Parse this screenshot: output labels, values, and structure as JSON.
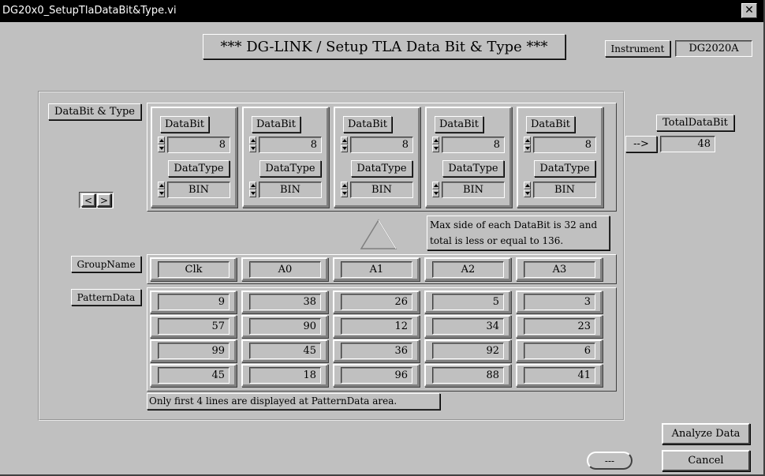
{
  "window": {
    "title": "DG20x0_SetupTlaDataBit&Type.vi",
    "close_glyph": "✕"
  },
  "header": {
    "title": "*** DG-LINK / Setup TLA Data Bit & Type ***"
  },
  "instrument": {
    "label": "Instrument",
    "value": "DG2020A"
  },
  "databit_type": {
    "label": "DataBit & Type",
    "cluster_labels": {
      "databit": "DataBit",
      "datatype": "DataType"
    },
    "clusters": [
      {
        "databit": "8",
        "datatype": "BIN"
      },
      {
        "databit": "8",
        "datatype": "BIN"
      },
      {
        "databit": "8",
        "datatype": "BIN"
      },
      {
        "databit": "8",
        "datatype": "BIN"
      },
      {
        "databit": "8",
        "datatype": "BIN"
      }
    ]
  },
  "scroll": {
    "prev": "<",
    "next": ">"
  },
  "total": {
    "label": "TotalDataBit",
    "arrow": "-->",
    "value": "48"
  },
  "note_max": "Max side of each DataBit is 32 and total is less or equal to 136.",
  "group": {
    "label": "GroupName",
    "names": [
      "Clk",
      "A0",
      "A1",
      "A2",
      "A3"
    ]
  },
  "pattern": {
    "label": "PatternData",
    "rows": [
      [
        "9",
        "38",
        "26",
        "5",
        "3"
      ],
      [
        "57",
        "90",
        "12",
        "34",
        "23"
      ],
      [
        "99",
        "45",
        "36",
        "92",
        "6"
      ],
      [
        "45",
        "18",
        "96",
        "88",
        "41"
      ]
    ]
  },
  "note_lines": "Only first 4 lines are displayed at PatternData area.",
  "buttons": {
    "analyze": "Analyze Data",
    "cancel": "Cancel",
    "status": "---"
  }
}
